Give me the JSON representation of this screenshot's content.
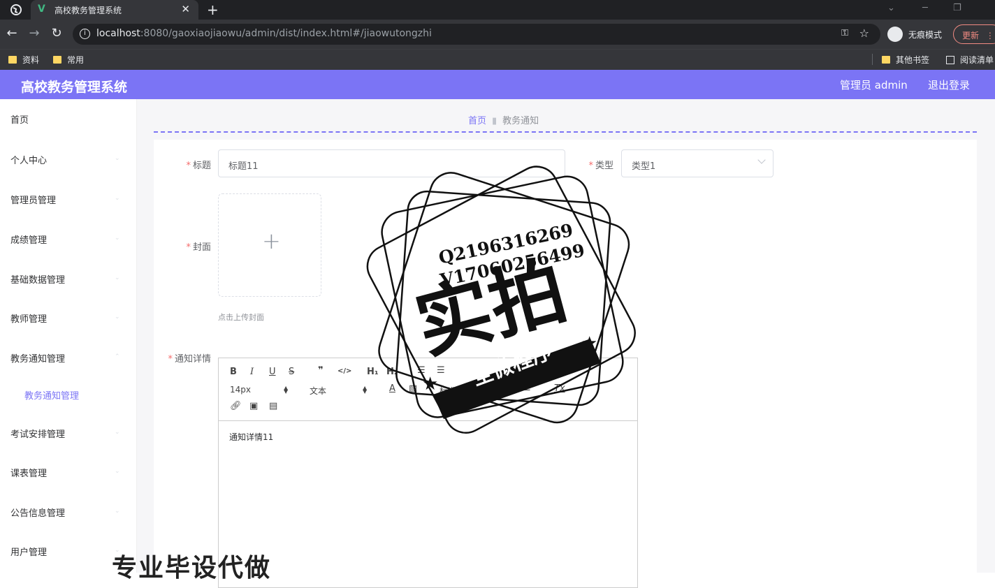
{
  "browser": {
    "tab_title": "高校教务管理系统",
    "tab_favicon": "V",
    "url_host": "localhost",
    "url_rest": ":8080/gaoxiaojiaowu/admin/dist/index.html#/jiaowutongzhi",
    "incognito_label": "无痕模式",
    "update_label": "更新",
    "bookmarks": [
      "资料",
      "常用"
    ],
    "other_bookmarks": "其他书签",
    "reading_list": "阅读清单",
    "icons": [
      "globe-icon",
      "close-icon",
      "plus-icon",
      "back-icon",
      "forward-icon",
      "reload-icon",
      "info-icon",
      "key-icon",
      "star-icon",
      "incognito-icon",
      "menu-icon",
      "folder-icon",
      "reading-list-icon"
    ]
  },
  "header": {
    "title": "高校教务管理系统",
    "user": "管理员 admin",
    "logout": "退出登录",
    "color": "#7b74f5"
  },
  "sidebar": {
    "items": [
      "首页",
      "个人中心",
      "管理员管理",
      "成绩管理",
      "基础数据管理",
      "教师管理",
      "教务通知管理",
      "考试安排管理",
      "课表管理",
      "公告信息管理",
      "用户管理"
    ],
    "sub_item": "教务通知管理"
  },
  "breadcrumb": {
    "home": "首页",
    "current": "教务通知"
  },
  "form": {
    "title_label": "标题",
    "title_value": "标题11",
    "type_label": "类型",
    "type_value": "类型1",
    "cover_label": "封面",
    "cover_hint": "点击上传封面",
    "detail_label": "通知详情",
    "detail_content": "通知详情11"
  },
  "editor_toolbar": {
    "bold": "B",
    "italic": "I",
    "underline": "U",
    "strike": "S",
    "quote": "❞",
    "code": "</>",
    "h1": "H₁",
    "h2": "H₂",
    "size": "14px",
    "font": "文本",
    "header": "标准字体",
    "clean": "Tx"
  },
  "watermark": {
    "qq": "Q2196316269",
    "wechat": "V17060256499",
    "big": "实拍",
    "ribbon": "全微程序",
    "bottom": "专业毕设代做"
  }
}
